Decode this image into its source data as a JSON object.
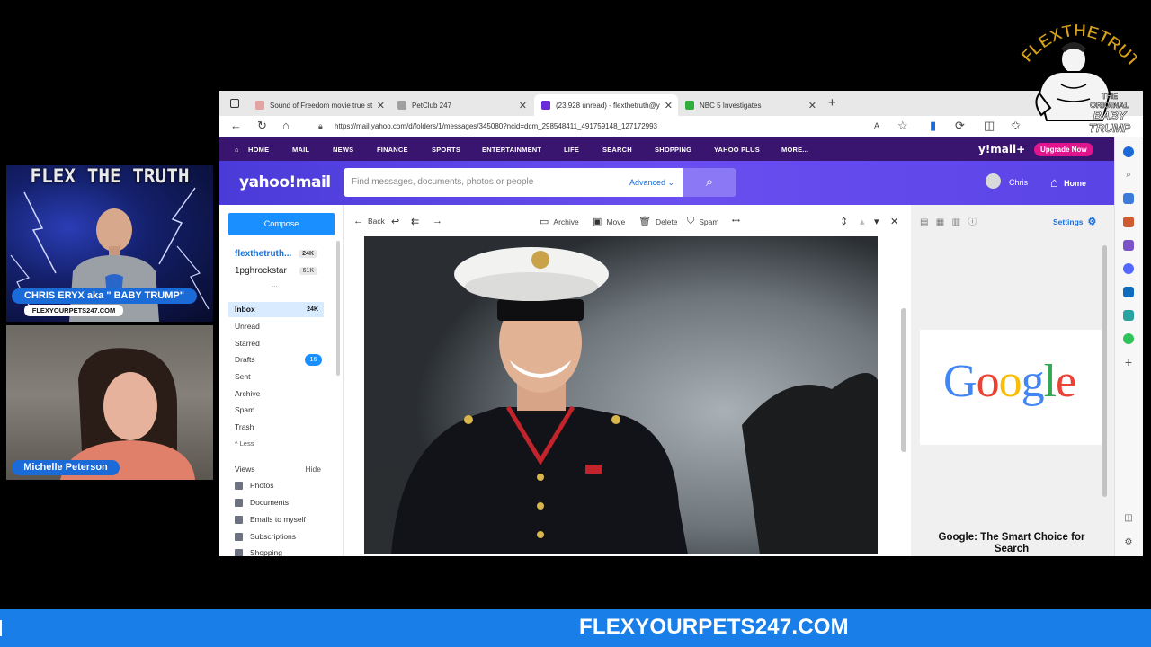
{
  "overlay": {
    "logo_text": "FLEXTHETRUTH",
    "logo_sub_1": "THE",
    "logo_sub_2": "ORIGINAL",
    "logo_sub_3": "BABY",
    "logo_sub_4": "TRUMP",
    "banner_text": "FLEXYOURPETS247.COM",
    "colors": {
      "banner": "#1a7ee8",
      "gold": "#d9a21a"
    }
  },
  "cam1": {
    "brand": "FLEX THE TRUTH",
    "name_tag": "CHRIS ERYX aka \" BABY TRUMP\"",
    "site_tag": "FLEXYOURPETS247.COM"
  },
  "cam2": {
    "name_tag": "Michelle Peterson"
  },
  "browser": {
    "tabs": [
      {
        "title": "Sound of Freedom movie true st",
        "fav_color": "#e4a3a3"
      },
      {
        "title": "PetClub 247",
        "fav_color": "#a0a0a0"
      },
      {
        "title": "(23,928 unread) - flexthetruth@y",
        "fav_color": "#6a2bd9",
        "active": true
      },
      {
        "title": "NBC 5 Investigates",
        "fav_color": "#2fae3c"
      }
    ],
    "url": "https://mail.yahoo.com/d/folders/1/messages/345080?ncid=dcm_298548411_491759148_127172993"
  },
  "ynav": {
    "items": [
      "HOME",
      "MAIL",
      "NEWS",
      "FINANCE",
      "SPORTS",
      "ENTERTAINMENT",
      "LIFE",
      "SEARCH",
      "SHOPPING",
      "YAHOO PLUS",
      "MORE..."
    ],
    "brand": "y!mail+",
    "upgrade": "Upgrade Now"
  },
  "yhead": {
    "logo": "yahoo!mail",
    "search_placeholder": "Find messages, documents, photos or people",
    "advanced": "Advanced",
    "user": "Chris",
    "home": "Home"
  },
  "left": {
    "compose": "Compose",
    "accounts": [
      {
        "name": "flexthetruth...",
        "count": "24K"
      },
      {
        "name": "1pghrockstar",
        "count": "61K"
      }
    ],
    "more_dots": "...",
    "folders": [
      {
        "label": "Inbox",
        "count": "24K"
      },
      {
        "label": "Unread"
      },
      {
        "label": "Starred"
      },
      {
        "label": "Drafts",
        "count": "16"
      },
      {
        "label": "Sent"
      },
      {
        "label": "Archive"
      },
      {
        "label": "Spam"
      },
      {
        "label": "Trash"
      },
      {
        "label": "^ Less"
      }
    ],
    "views_label": "Views",
    "views_hide": "Hide",
    "views": [
      "Photos",
      "Documents",
      "Emails to myself",
      "Subscriptions",
      "Shopping"
    ]
  },
  "msgbar": {
    "back": "Back",
    "archive": "Archive",
    "move": "Move",
    "delete": "Delete",
    "spam": "Spam",
    "more": "•••"
  },
  "right": {
    "settings": "Settings",
    "ad_brand": "Google",
    "ad_caption": "Google: The Smart Choice for Search"
  }
}
